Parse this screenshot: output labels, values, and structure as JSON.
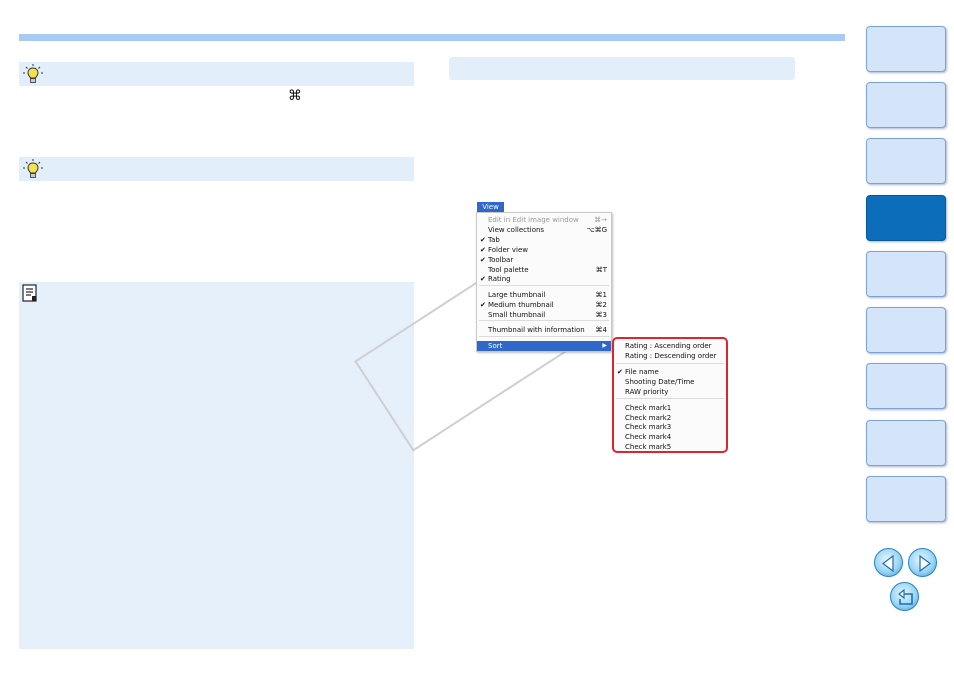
{
  "tips": {
    "tip1_icon": "lightbulb-icon",
    "tip2_icon": "lightbulb-icon",
    "command_glyph": "⌘"
  },
  "note": {
    "icon": "memo-icon"
  },
  "menu": {
    "title": "View",
    "items": [
      {
        "label": "Edit in Edit image window",
        "shortcut": "⌘→",
        "checked": false,
        "disabled": true
      },
      {
        "label": "View collections",
        "shortcut": "⌥⌘G",
        "checked": false,
        "disabled": false
      },
      {
        "label": "Tab",
        "shortcut": "",
        "checked": true,
        "disabled": false
      },
      {
        "label": "Folder view",
        "shortcut": "",
        "checked": true,
        "disabled": false
      },
      {
        "label": "Toolbar",
        "shortcut": "",
        "checked": true,
        "disabled": false
      },
      {
        "label": "Tool palette",
        "shortcut": "⌘T",
        "checked": false,
        "disabled": false
      },
      {
        "label": "Rating",
        "shortcut": "",
        "checked": true,
        "disabled": false
      },
      {
        "label": "Large thumbnail",
        "shortcut": "⌘1",
        "checked": false,
        "disabled": false
      },
      {
        "label": "Medium thumbnail",
        "shortcut": "⌘2",
        "checked": true,
        "disabled": false
      },
      {
        "label": "Small thumbnail",
        "shortcut": "⌘3",
        "checked": false,
        "disabled": false
      },
      {
        "label": "Thumbnail with information",
        "shortcut": "⌘4",
        "checked": false,
        "disabled": false
      },
      {
        "label": "Sort",
        "shortcut": "",
        "checked": false,
        "disabled": false,
        "selected": true
      }
    ],
    "check_glyph": "✔",
    "submenu_arrow": "▶"
  },
  "submenu": {
    "items": [
      {
        "label": "Rating : Ascending order",
        "checked": false
      },
      {
        "label": "Rating : Descending order",
        "checked": false
      },
      {
        "label": "File name",
        "checked": true
      },
      {
        "label": "Shooting Date/Time",
        "checked": false
      },
      {
        "label": "RAW priority",
        "checked": false
      },
      {
        "label": "Check mark1",
        "checked": false
      },
      {
        "label": "Check mark2",
        "checked": false
      },
      {
        "label": "Check mark3",
        "checked": false
      },
      {
        "label": "Check mark4",
        "checked": false
      },
      {
        "label": "Check mark5",
        "checked": false
      }
    ]
  },
  "sidebar": {
    "tab_count": 9,
    "active_index": 3
  },
  "nav": {
    "prev_icon": "arrow-left-icon",
    "next_icon": "arrow-right-icon",
    "return_icon": "return-icon"
  },
  "colors": {
    "accent": "#2f68c7",
    "highlight_frame": "#e0242f",
    "active_tab": "#0c6dbb",
    "tab": "#d4e4f9",
    "panel": "#e5f0fb"
  }
}
